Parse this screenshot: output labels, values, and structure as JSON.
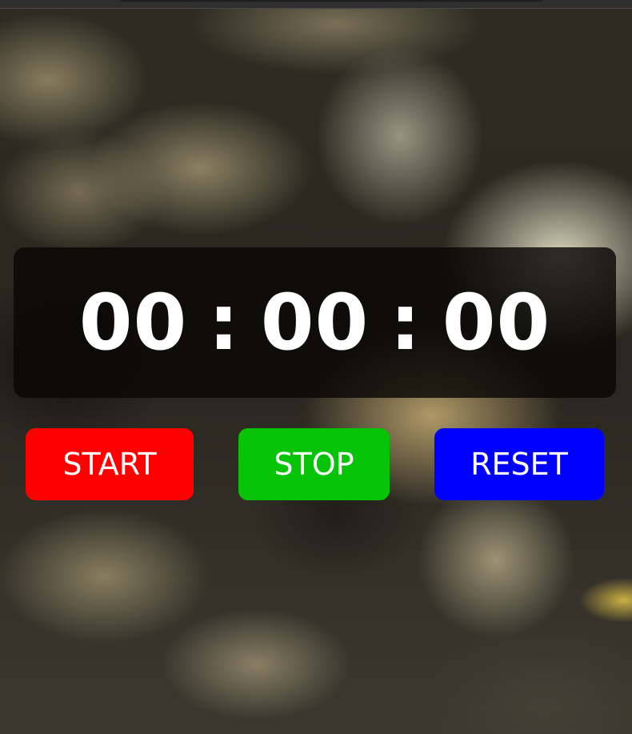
{
  "timer": {
    "hours": "00",
    "minutes": "00",
    "seconds": "00",
    "separator": ":"
  },
  "buttons": {
    "start": {
      "label": "START",
      "color": "#ff0000"
    },
    "stop": {
      "label": "STOP",
      "color": "#08c408"
    },
    "reset": {
      "label": "RESET",
      "color": "#0000ff"
    }
  }
}
